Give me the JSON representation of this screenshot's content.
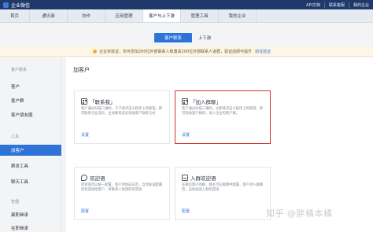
{
  "app": {
    "title": "企业微信",
    "top_links": [
      "API文档",
      "联系客服",
      "我的企业"
    ]
  },
  "nav": {
    "items": [
      {
        "label": "首页",
        "active": false
      },
      {
        "label": "通讯录",
        "active": false
      },
      {
        "label": "协作",
        "active": false
      },
      {
        "label": "应用管理",
        "active": false
      },
      {
        "label": "客户与上下游",
        "active": true
      },
      {
        "label": "管理工具",
        "active": false
      },
      {
        "label": "我的企业",
        "active": false
      }
    ]
  },
  "subtabs": {
    "active": "客户联系",
    "other": "上下游"
  },
  "notice": {
    "text": "企业未验证，仅可添加200位外部联系人和邀请200位外部联系人进群，验证后即可提升",
    "link": "前往验证"
  },
  "sidebar": {
    "items": [
      {
        "label": "客户联系",
        "type": "section"
      },
      {
        "label": "客户",
        "type": "item"
      },
      {
        "label": "客户群",
        "type": "item"
      },
      {
        "label": "客户朋友圈",
        "type": "item"
      },
      {
        "label": "工具",
        "type": "section"
      },
      {
        "label": "加客户",
        "type": "item",
        "active": true
      },
      {
        "label": "群发工具",
        "type": "item"
      },
      {
        "label": "聊天工具",
        "type": "item"
      },
      {
        "label": "管理",
        "type": "section"
      },
      {
        "label": "离职继承",
        "type": "item"
      },
      {
        "label": "在职继承",
        "type": "item"
      }
    ]
  },
  "main": {
    "title": "加客户",
    "cards": [
      {
        "title": "「联系我」",
        "desc": "客户通过扫描二维码、工卡或点击小程序上的按钮，即可联系企业成员，主动联系成员添加客户联系方式",
        "link": "设置",
        "icon": "qr-icon",
        "highlight": false
      },
      {
        "title": "「加入群聊」",
        "desc": "客户通过扫描二维码，立即或点击小程序上的按钮，即可添加客户群的，进入企业的客户群。",
        "link": "设置",
        "icon": "qr-icon",
        "highlight": true
      },
      {
        "title": "欢迎语",
        "desc": "欢迎语可以统一配置，客户添加成员后，自动发送配置的欢迎语给客户，将联系人加添的欢迎语",
        "link": "配置",
        "icon": "chat-icon",
        "highlight": false
      },
      {
        "title": "入群欢迎语",
        "desc": "在微信客户的群，群主可在群聊中配置，客户进入群聊后，自动发送入群欢迎语",
        "link": "配置",
        "icon": "card-icon",
        "highlight": false
      }
    ]
  },
  "watermark": "知乎 @胖橘本橘"
}
